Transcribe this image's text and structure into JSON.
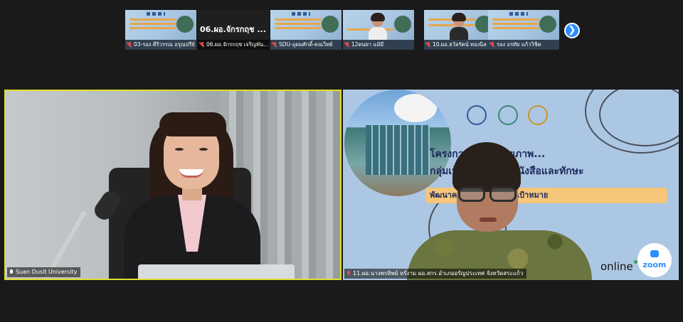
{
  "thumbnails": [
    {
      "label": "03-รอง ศิริวรรณ อรุณปรีย์",
      "type": "slide"
    },
    {
      "label": "06.ผอ.จักรกฤช เจริญพัน...",
      "type": "name",
      "display_name": "06.ผอ.จักรกฤช ..."
    },
    {
      "label": "SDU-อุดมศักดิ์-คณวิทย์",
      "type": "slide"
    },
    {
      "label": "12ดนยา แม้มี",
      "type": "face"
    },
    {
      "label": "10.ผอ.ธวัลรัตน์ ทองนิล",
      "type": "face"
    },
    {
      "label": "รอง อรทัย แก้ววิชิต",
      "type": "slide"
    }
  ],
  "next_button": "❯",
  "main_tiles": {
    "left": {
      "name": "Suan Dusit University",
      "muted": false
    },
    "right": {
      "name": "11.ผอ.นางพรทิพย์ หรั่งาม ผอ.สกร.อำเภออรัญประเทศ จังหวัดสระแก้ว",
      "muted": true,
      "slide_title_1": "โครงการพัฒนาศักยภาพ...",
      "slide_title_2": "กลุ่มเป้าหมายผู้ไม่รู้หนังสือและทักษะ",
      "slide_title_3": "พัฒนาครูผู้ดูแลผู้เรียนกลุ่มเป้าหมาย",
      "online_text": "online",
      "zoom_text": "zoom"
    }
  },
  "colors": {
    "active_speaker_border": "#dede2a",
    "zoom_blue": "#2d8cff",
    "muted_red": "#e04b4b"
  }
}
